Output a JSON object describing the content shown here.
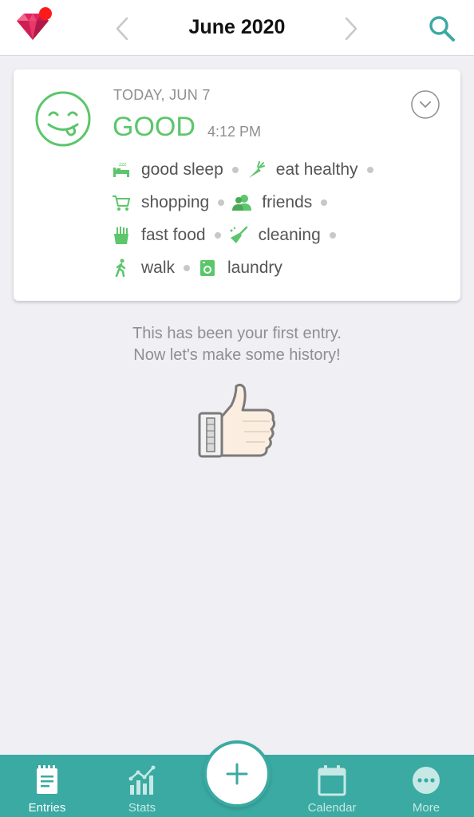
{
  "header": {
    "title": "June 2020",
    "badge_color": "#ff1a1a",
    "gem_color": "#e0245e",
    "accent": "#3aaaa2"
  },
  "entry": {
    "date": "TODAY, JUN 7",
    "mood": "GOOD",
    "time": "4:12 PM",
    "mood_color": "#5cc66b",
    "activities": [
      [
        {
          "label": "good sleep",
          "icon": "bed-icon"
        },
        {
          "label": "eat healthy",
          "icon": "carrot-icon"
        }
      ],
      [
        {
          "label": "shopping",
          "icon": "cart-icon"
        },
        {
          "label": "friends",
          "icon": "friends-icon"
        }
      ],
      [
        {
          "label": "fast food",
          "icon": "fries-icon"
        },
        {
          "label": "cleaning",
          "icon": "broom-icon"
        }
      ],
      [
        {
          "label": "walk",
          "icon": "walk-icon"
        },
        {
          "label": "laundry",
          "icon": "washer-icon"
        }
      ]
    ]
  },
  "empty_state": {
    "line1": "This has been your first entry.",
    "line2": "Now let's make some history!"
  },
  "tabbar": {
    "tabs": [
      {
        "label": "Entries",
        "icon": "entries-icon",
        "active": true
      },
      {
        "label": "Stats",
        "icon": "stats-icon",
        "active": false
      },
      {
        "label": "Calendar",
        "icon": "calendar-icon",
        "active": false
      },
      {
        "label": "More",
        "icon": "more-icon",
        "active": false
      }
    ],
    "add_icon": "plus-icon"
  }
}
